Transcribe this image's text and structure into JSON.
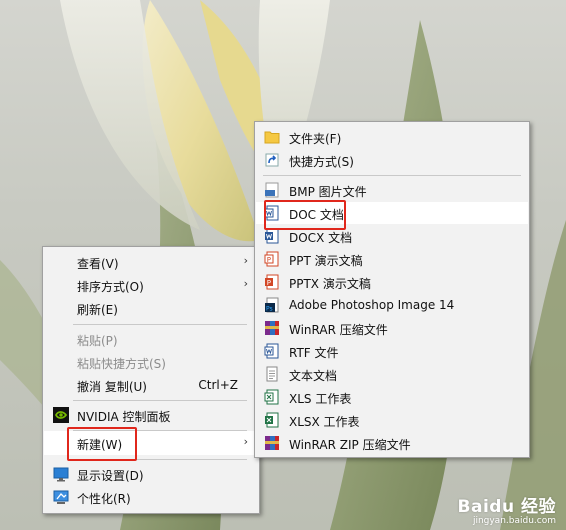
{
  "context_menu": {
    "items": [
      {
        "label": "查看(V)",
        "has_arrow": true
      },
      {
        "label": "排序方式(O)",
        "has_arrow": true
      },
      {
        "label": "刷新(E)"
      },
      {
        "label": "粘贴(P)",
        "disabled": true
      },
      {
        "label": "粘贴快捷方式(S)",
        "disabled": true
      },
      {
        "label": "撤消 复制(U)",
        "shortcut": "Ctrl+Z"
      },
      {
        "label": "NVIDIA 控制面板",
        "icon": "nvidia-icon"
      },
      {
        "label": "新建(W)",
        "has_arrow": true,
        "highlighted": true
      },
      {
        "label": "显示设置(D)",
        "icon": "display-icon"
      },
      {
        "label": "个性化(R)",
        "icon": "personalize-icon"
      }
    ],
    "arrow_glyph": "›"
  },
  "new_submenu": {
    "items": [
      {
        "label": "文件夹(F)",
        "icon": "folder-icon"
      },
      {
        "label": "快捷方式(S)",
        "icon": "shortcut-icon"
      },
      {
        "label": "BMP 图片文件",
        "icon": "bmp-icon"
      },
      {
        "label": "DOC 文档",
        "icon": "word-doc-icon",
        "highlighted": true
      },
      {
        "label": "DOCX 文档",
        "icon": "word-docx-icon"
      },
      {
        "label": "PPT 演示文稿",
        "icon": "ppt-icon"
      },
      {
        "label": "PPTX 演示文稿",
        "icon": "pptx-icon"
      },
      {
        "label": "Adobe Photoshop Image 14",
        "icon": "photoshop-icon"
      },
      {
        "label": "WinRAR 压缩文件",
        "icon": "winrar-icon"
      },
      {
        "label": "RTF 文件",
        "icon": "rtf-icon"
      },
      {
        "label": "文本文档",
        "icon": "text-doc-icon"
      },
      {
        "label": "XLS 工作表",
        "icon": "xls-icon"
      },
      {
        "label": "XLSX 工作表",
        "icon": "xlsx-icon"
      },
      {
        "label": "WinRAR ZIP 压缩文件",
        "icon": "winrar-zip-icon"
      }
    ]
  },
  "watermark": {
    "brand": "Baidu 经验",
    "url": "jingyan.baidu.com"
  },
  "colors": {
    "highlight_box": "#e0271c",
    "menu_bg": "#f2f2f2"
  }
}
